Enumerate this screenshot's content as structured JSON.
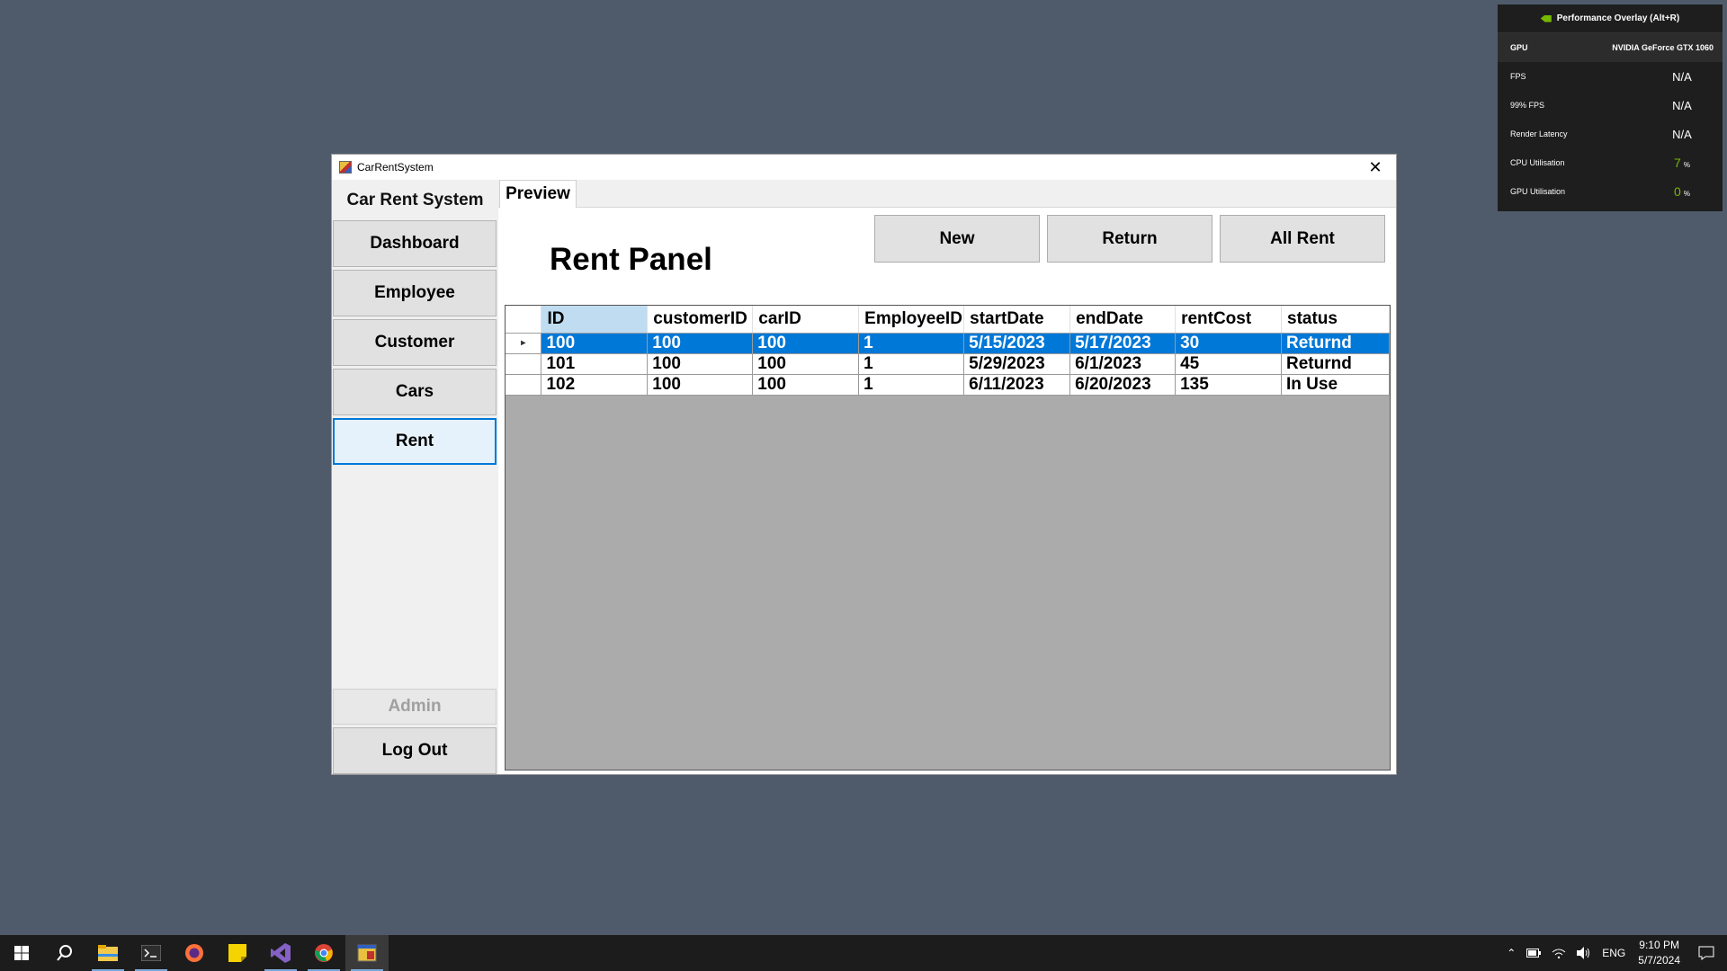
{
  "overlay": {
    "title": "Performance Overlay (Alt+R)",
    "rows": [
      {
        "label": "GPU",
        "value": "NVIDIA GeForce GTX 1060",
        "unit": ""
      },
      {
        "label": "FPS",
        "value": "N/A",
        "unit": ""
      },
      {
        "label": "99% FPS",
        "value": "N/A",
        "unit": ""
      },
      {
        "label": "Render Latency",
        "value": "N/A",
        "unit": ""
      },
      {
        "label": "CPU Utilisation",
        "value": "7",
        "unit": "%"
      },
      {
        "label": "GPU Utilisation",
        "value": "0",
        "unit": "%"
      }
    ]
  },
  "window": {
    "title": "CarRentSystem",
    "close_glyph": "✕"
  },
  "sidebar": {
    "title": "Car Rent System",
    "items": [
      {
        "label": "Dashboard"
      },
      {
        "label": "Employee"
      },
      {
        "label": "Customer"
      },
      {
        "label": "Cars"
      },
      {
        "label": "Rent"
      }
    ],
    "active": "Rent",
    "admin_label": "Admin",
    "logout_label": "Log Out"
  },
  "tabs": [
    {
      "label": "Preview"
    }
  ],
  "panel": {
    "title": "Rent Panel",
    "buttons": [
      {
        "label": "New"
      },
      {
        "label": "Return"
      },
      {
        "label": "All Rent"
      }
    ]
  },
  "table": {
    "columns": [
      "ID",
      "customerID",
      "carID",
      "EmployeeID",
      "startDate",
      "endDate",
      "rentCost",
      "status"
    ],
    "rows": [
      [
        "100",
        "100",
        "100",
        "1",
        "5/15/2023",
        "5/17/2023",
        "30",
        "Returnd"
      ],
      [
        "101",
        "100",
        "100",
        "1",
        "5/29/2023",
        "6/1/2023",
        "45",
        "Returnd"
      ],
      [
        "102",
        "100",
        "100",
        "1",
        "6/11/2023",
        "6/20/2023",
        "135",
        "In Use"
      ]
    ],
    "selected_row": 0,
    "row_indicator": "▸"
  },
  "taskbar": {
    "lang": "ENG",
    "time": "9:10 PM",
    "date": "5/7/2024"
  },
  "colors": {
    "desktop": "#4f5b6a",
    "selection": "#0078d7",
    "accent_green": "#76b900"
  }
}
